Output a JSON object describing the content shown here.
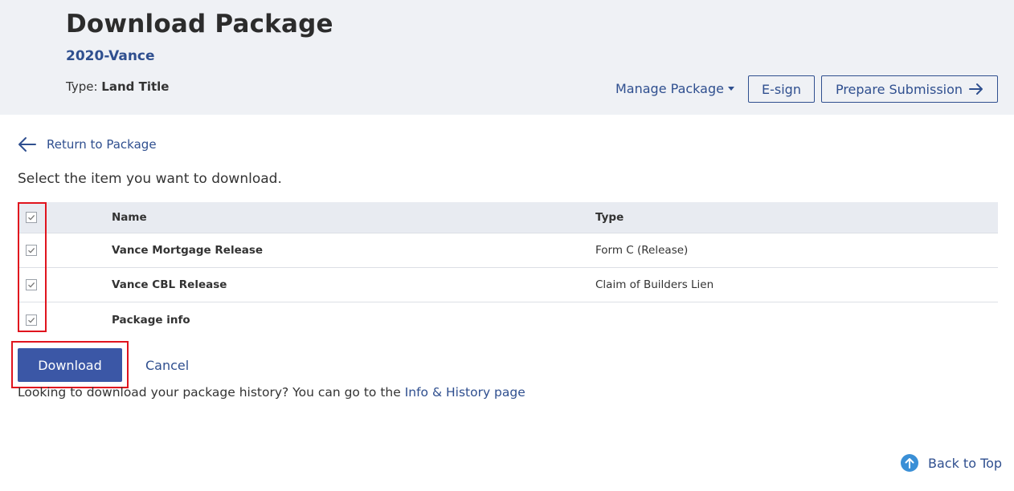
{
  "header": {
    "title": "Download Package",
    "subtitle": "2020-Vance",
    "type_label": "Type: ",
    "type_value": "Land Title",
    "manage_label": "Manage Package",
    "esign_label": "E-sign",
    "prepare_label": "Prepare Submission"
  },
  "nav": {
    "return_label": "Return to Package"
  },
  "instruction": "Select the item you want to download.",
  "table": {
    "col_name": "Name",
    "col_type": "Type",
    "rows": [
      {
        "name": "Vance Mortgage Release",
        "type": "Form C (Release)",
        "checked": true
      },
      {
        "name": "Vance CBL Release",
        "type": "Claim of Builders Lien",
        "checked": true
      },
      {
        "name": "Package info",
        "type": "",
        "checked": true
      }
    ],
    "all_checked": true
  },
  "actions": {
    "download_label": "Download",
    "cancel_label": "Cancel"
  },
  "history": {
    "text": "Looking to download your package history? You can go to the ",
    "link_label": "Info & History page"
  },
  "footer": {
    "back_to_top_label": "Back to Top"
  },
  "colors": {
    "primary": "#2f4f8f",
    "button": "#3b57a6",
    "highlight": "#e0141e",
    "header_bg": "#eff1f5"
  },
  "icons": {
    "return": "arrow-left-icon",
    "prepare": "arrow-right-icon",
    "manage": "caret-down-icon",
    "back_to_top": "arrow-up-circle-icon",
    "checkbox": "checkmark-icon"
  }
}
